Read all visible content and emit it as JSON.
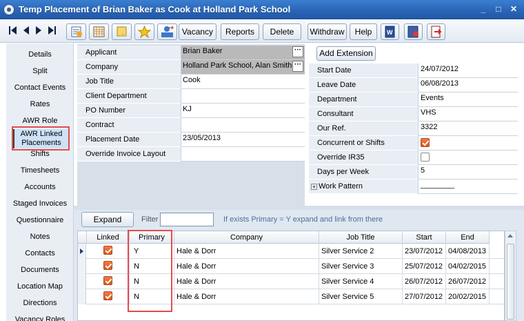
{
  "window": {
    "title": "Temp Placement of Brian Baker as Cook at Holland Park School",
    "controls": [
      "_",
      "□",
      "✕"
    ]
  },
  "toolbar": {
    "buttons": [
      "Vacancy",
      "Reports",
      "Delete",
      "Withdraw",
      "Help"
    ]
  },
  "sidenav": {
    "items": [
      "Details",
      "Split",
      "Contact Events",
      "Rates",
      "AWR Role",
      "AWR Linked Placements",
      "Shifts",
      "Timesheets",
      "Accounts",
      "Staged Invoices",
      "Questionnaire",
      "Notes",
      "Contacts",
      "Documents",
      "Location Map",
      "Directions",
      "Vacancy Roles"
    ]
  },
  "form_left": {
    "rows": [
      {
        "label": "Applicant",
        "value": "Brian Baker"
      },
      {
        "label": "Company",
        "value": "Holland Park School, Alan Smith"
      },
      {
        "label": "Job Title",
        "value": "Cook"
      },
      {
        "label": "Client Department",
        "value": ""
      },
      {
        "label": "PO Number",
        "value": "KJ"
      },
      {
        "label": "Contract",
        "value": ""
      },
      {
        "label": "Placement Date",
        "value": "23/05/2013"
      },
      {
        "label": "Override Invoice Layout",
        "value": ""
      }
    ],
    "ellipsis": "···"
  },
  "form_right": {
    "add_extension": "Add Extension",
    "rows": [
      {
        "label": "Start Date",
        "value": "24/07/2012"
      },
      {
        "label": "Leave Date",
        "value": "06/08/2013"
      },
      {
        "label": "Department",
        "value": "Events"
      },
      {
        "label": "Consultant",
        "value": "VHS"
      },
      {
        "label": "Our Ref.",
        "value": "3322"
      },
      {
        "label": "Concurrent or Shifts",
        "value": "",
        "checked": true
      },
      {
        "label": "Override IR35",
        "value": "",
        "checked": false
      },
      {
        "label": "Days per Week",
        "value": "5"
      },
      {
        "label": "Work Pattern",
        "value": "________"
      }
    ],
    "expander": "+"
  },
  "grid_area": {
    "expand_label": "Expand",
    "filter_label": "Filter",
    "filter_value": "",
    "hint": "If exists Primary = Y expand and link from there",
    "columns": [
      "Linked",
      "Primary",
      "Company",
      "Job Title",
      "Start",
      "End"
    ],
    "rows": [
      {
        "linked": true,
        "primary": "Y",
        "company": "Hale & Dorr",
        "job_title": "Silver Service 2",
        "start": "23/07/2012",
        "end": "04/08/2013"
      },
      {
        "linked": true,
        "primary": "N",
        "company": "Hale & Dorr",
        "job_title": "Silver Service 3",
        "start": "25/07/2012",
        "end": "04/02/2015"
      },
      {
        "linked": true,
        "primary": "N",
        "company": "Hale & Dorr",
        "job_title": "Silver Service 4",
        "start": "26/07/2012",
        "end": "26/07/2012"
      },
      {
        "linked": true,
        "primary": "N",
        "company": "Hale & Dorr",
        "job_title": "Silver Service 5",
        "start": "27/07/2012",
        "end": "20/02/2015"
      }
    ]
  },
  "colors": {
    "title_bar": "#2a66b8",
    "highlight_box": "#e54b4b",
    "checkbox_on": "#e8682f",
    "panel_bg": "#e9eef5"
  }
}
